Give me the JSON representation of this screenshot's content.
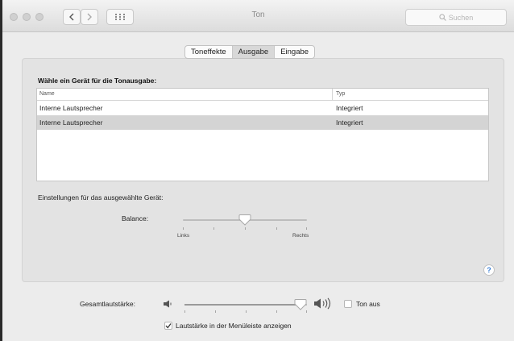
{
  "window": {
    "title": "Ton"
  },
  "search": {
    "placeholder": "Suchen"
  },
  "tabs": [
    {
      "label": "Toneffekte",
      "active": false
    },
    {
      "label": "Ausgabe",
      "active": true
    },
    {
      "label": "Eingabe",
      "active": false
    }
  ],
  "output": {
    "heading": "Wähle ein Gerät für die Tonausgabe:",
    "columns": [
      "Name",
      "Typ"
    ],
    "rows": [
      {
        "name": "Interne Lautsprecher",
        "type": "Integriert",
        "selected": false
      },
      {
        "name": "Interne Lautsprecher",
        "type": "Integriert",
        "selected": true
      }
    ]
  },
  "settings": {
    "label": "Einstellungen für das ausgewählte Gerät:",
    "balance_label": "Balance:",
    "balance_value": 0.5,
    "left_label": "Links",
    "right_label": "Rechts"
  },
  "help": {
    "symbol": "?"
  },
  "volume": {
    "label": "Gesamtlautstärke:",
    "level": 0.94,
    "mute_label": "Ton aus",
    "mute_checked": false,
    "menubar_label": "Lautstärke in der Menüleiste anzeigen",
    "menubar_checked": true
  },
  "colors": {
    "accent": "#3a7fd6",
    "selection": "#d4d4d4"
  }
}
